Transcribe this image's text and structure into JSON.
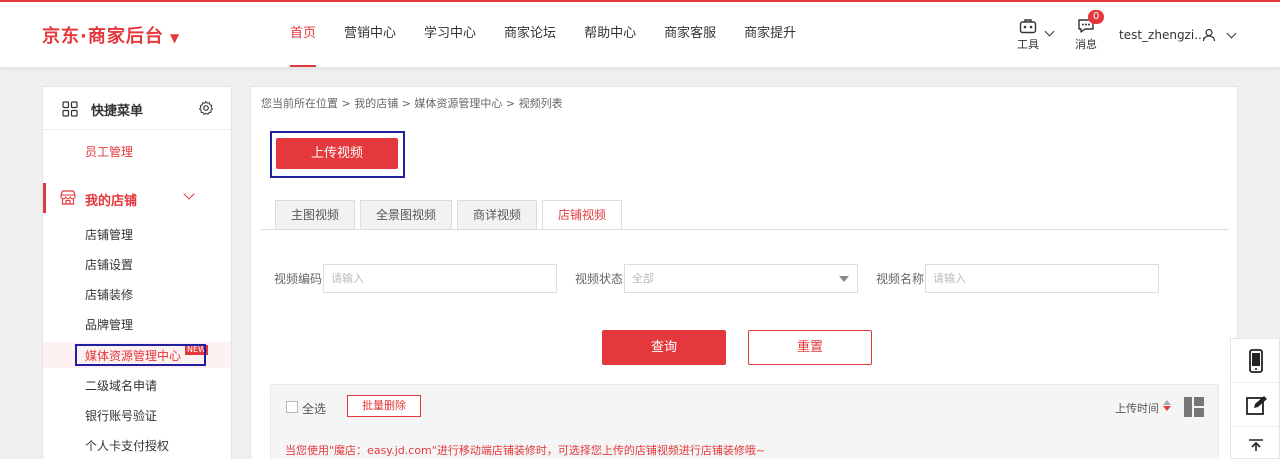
{
  "brand": {
    "logo_text": "京东·商家后台",
    "logo_caret": "▼"
  },
  "nav": {
    "items": [
      "首页",
      "营销中心",
      "学习中心",
      "商家论坛",
      "帮助中心",
      "商家客服",
      "商家提升"
    ],
    "active_index": 0
  },
  "toolbar": {
    "tools_label": "工具",
    "messages_label": "消息",
    "messages_badge": "0",
    "username": "test_zhengzi..."
  },
  "sidebar": {
    "title": "快捷菜单",
    "shortcut": "员工管理",
    "section": "我的店铺",
    "items": [
      "店铺管理",
      "店铺设置",
      "店铺装修",
      "品牌管理",
      "媒体资源管理中心",
      "二级域名申请",
      "银行账号验证",
      "个人卡支付授权"
    ],
    "active_item": "媒体资源管理中心",
    "new_tag": "NEW"
  },
  "breadcrumb": {
    "text": "您当前所在位置 > 我的店铺 > 媒体资源管理中心 > 视频列表"
  },
  "main": {
    "upload_button": "上传视频",
    "tabs": [
      "主图视频",
      "全景图视频",
      "商详视频",
      "店铺视频"
    ],
    "active_tab_index": 3,
    "filters": {
      "code_label": "视频编码",
      "code_placeholder": "请输入",
      "status_label": "视频状态",
      "status_value": "全部",
      "name_label": "视频名称",
      "name_placeholder": "请输入"
    },
    "query_button": "查询",
    "reset_button": "重置",
    "list": {
      "select_all": "全选",
      "batch_delete": "批量删除",
      "sort_label": "上传时间",
      "notice": "当您使用\"魔店：easy.jd.com\"进行移动端店铺装修时，可选择您上传的店铺视频进行店铺装修哦~"
    }
  },
  "colors": {
    "accent": "#e4393c",
    "highlight_box": "#1f1fa0"
  }
}
